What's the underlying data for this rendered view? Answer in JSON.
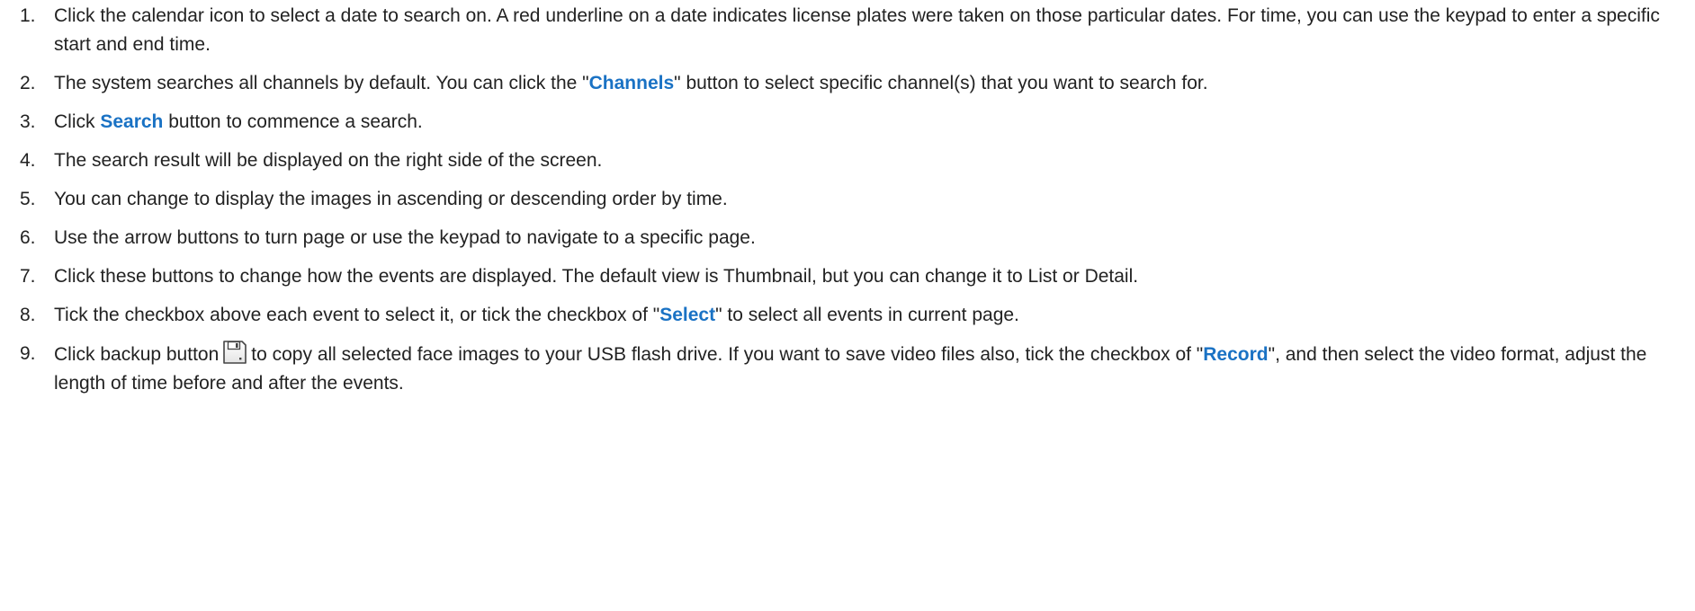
{
  "steps": [
    {
      "num": "1.",
      "text": "Click the calendar icon to select a date to search on. A red underline on a date indicates license plates were taken on those particular dates. For time, you can use the keypad to enter a specific start and end time."
    },
    {
      "num": "2.",
      "before": "The system searches all channels by default. You can click the \"",
      "keyword": "Channels",
      "after": "\" button to select specific channel(s) that you want to search for."
    },
    {
      "num": "3.",
      "before": "Click ",
      "keyword": "Search",
      "after": " button to commence a search."
    },
    {
      "num": "4.",
      "text": "The search result will be displayed on the right side of the screen."
    },
    {
      "num": "5.",
      "text": "You can change to display the images in ascending or descending order by time."
    },
    {
      "num": "6.",
      "text": "Use the arrow buttons to turn page or use the keypad to navigate to a specific page."
    },
    {
      "num": "7.",
      "text": "Click these buttons to change how the events are displayed. The default view is Thumbnail, but you can change it to List or Detail."
    },
    {
      "num": "8.",
      "before": "Tick the checkbox above each event to select it, or tick the checkbox of \"",
      "keyword": "Select",
      "after": "\" to select all events in current page."
    },
    {
      "num": "9.",
      "before": "Click backup button",
      "icon": "backup-icon",
      "middle": "to copy all selected face images to your USB flash drive. If you want to save video files also, tick the checkbox of \"",
      "keyword": "Record",
      "after": "\", and then select the video format, adjust the length of time before and after the events."
    }
  ],
  "colors": {
    "text": "#222222",
    "keyword": "#1a72c4",
    "background": "#ffffff"
  }
}
